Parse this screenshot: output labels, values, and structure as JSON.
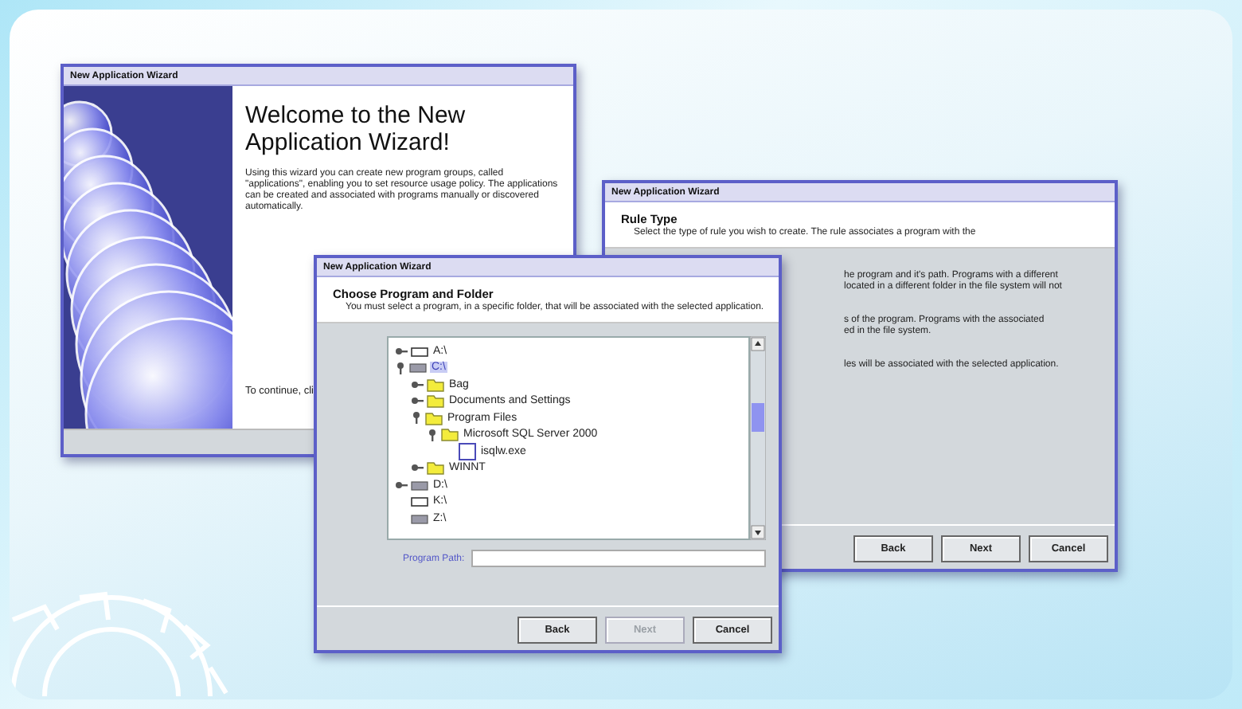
{
  "windows": [
    {
      "kind": "welcome",
      "title": "New Application Wizard",
      "heading": "Welcome to the New Application Wizard!",
      "text": "Using this wizard you can create new program groups, called \"applications\", enabling you to set resource usage policy. The applications can be created and associated with programs manually or discovered automatically.",
      "footer_text": "To continue, cli"
    },
    {
      "kind": "rule",
      "title": "New Application Wizard",
      "heading": "Rule Type",
      "description": "Select the type of rule you wish to create. The rule associates a program with the",
      "body_lines": [
        [
          "he program and it's path. Programs with a different",
          "located in a different folder in the file system will not"
        ],
        [
          "s of the program. Programs with the associated",
          "ed in the file system."
        ],
        [
          "les will be associated with the selected application."
        ]
      ],
      "buttons": [
        {
          "label": "Back",
          "disabled": false
        },
        {
          "label": "Next",
          "disabled": false
        },
        {
          "label": "Cancel",
          "disabled": false
        }
      ]
    },
    {
      "kind": "folder",
      "title": "New Application Wizard",
      "heading": "Choose Program and Folder",
      "description": "You must select a program, in a specific folder, that will be associated with the selected application.",
      "tree": [
        {
          "label": "A:\\",
          "kind": "floppy",
          "expanded": false,
          "selected": false
        },
        {
          "label": "C:\\",
          "kind": "drive",
          "expanded": true,
          "selected": true,
          "children": [
            {
              "label": "Bag",
              "kind": "folder",
              "expanded": false,
              "selected": false
            },
            {
              "label": "Documents and Settings",
              "kind": "folder",
              "expanded": false,
              "selected": false
            },
            {
              "label": "Program Files",
              "kind": "folder",
              "expanded": true,
              "selected": false,
              "children": [
                {
                  "label": "Microsoft SQL Server 2000",
                  "kind": "folder",
                  "expanded": true,
                  "selected": false,
                  "children": [
                    {
                      "label": "isqlw.exe",
                      "kind": "file",
                      "selected": false
                    }
                  ]
                }
              ]
            },
            {
              "label": "WINNT",
              "kind": "folder",
              "expanded": false,
              "selected": false
            }
          ]
        },
        {
          "label": "D:\\",
          "kind": "drive",
          "expanded": false,
          "selected": false
        },
        {
          "label": "K:\\",
          "kind": "floppy",
          "selected": false
        },
        {
          "label": "Z:\\",
          "kind": "drive",
          "selected": false
        }
      ],
      "path_label": "Program Path:",
      "buttons": [
        {
          "label": "Back",
          "disabled": false
        },
        {
          "label": "Next",
          "disabled": true
        },
        {
          "label": "Cancel",
          "disabled": false
        }
      ]
    }
  ]
}
